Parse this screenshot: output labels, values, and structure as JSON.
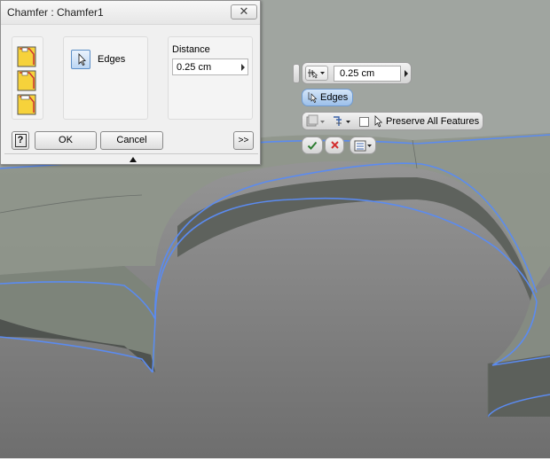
{
  "dialog": {
    "title": "Chamfer : Chamfer1",
    "close_icon": "close-icon",
    "chamfer_types": [
      {
        "icon": "chamfer-distance-icon"
      },
      {
        "icon": "chamfer-distance-angle-icon"
      },
      {
        "icon": "chamfer-two-distances-icon"
      }
    ],
    "edges_label": "Edges",
    "distance_label": "Distance",
    "distance_value": "0.25 cm",
    "help_label": "?",
    "ok_label": "OK",
    "cancel_label": "Cancel",
    "more_label": ">>"
  },
  "minitoolbar": {
    "distance_value": "0.25 cm",
    "edges_label": "Edges",
    "preserve_label": "Preserve All Features",
    "preserve_checked": false,
    "colors": {
      "accent": "#9cc0ea",
      "ok": "#2e7d32",
      "cancel": "#d32f2f"
    }
  },
  "viewport": {
    "background_top": "#a6a6a6",
    "background_bottom": "#707070",
    "highlight_color": "#5b8bf0"
  }
}
